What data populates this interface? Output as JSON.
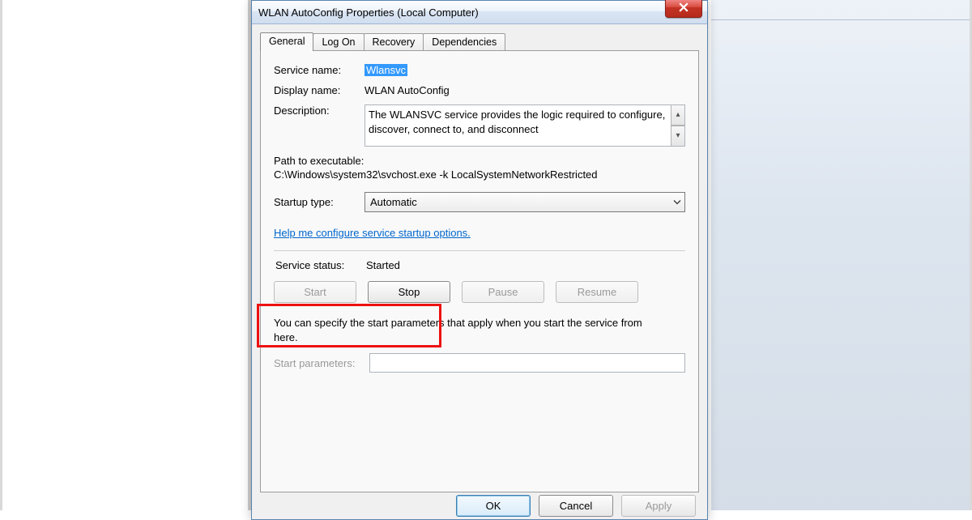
{
  "window": {
    "title": "WLAN AutoConfig Properties (Local Computer)"
  },
  "tabs": [
    {
      "label": "General"
    },
    {
      "label": "Log On"
    },
    {
      "label": "Recovery"
    },
    {
      "label": "Dependencies"
    }
  ],
  "labels": {
    "service_name": "Service name:",
    "display_name": "Display name:",
    "description": "Description:",
    "path_heading": "Path to executable:",
    "startup_type": "Startup type:",
    "help_link": "Help me configure service startup options.",
    "service_status": "Service status:",
    "hint": "You can specify the start parameters that apply when you start the service from here.",
    "start_parameters": "Start parameters:"
  },
  "values": {
    "service_name": "Wlansvc",
    "display_name": "WLAN AutoConfig",
    "description": "The WLANSVC service provides the logic required to configure, discover, connect to, and disconnect",
    "path": "C:\\Windows\\system32\\svchost.exe -k LocalSystemNetworkRestricted",
    "startup_type": "Automatic",
    "status": "Started",
    "start_parameters": ""
  },
  "buttons": {
    "start": "Start",
    "stop": "Stop",
    "pause": "Pause",
    "resume": "Resume",
    "ok": "OK",
    "cancel": "Cancel",
    "apply": "Apply"
  }
}
